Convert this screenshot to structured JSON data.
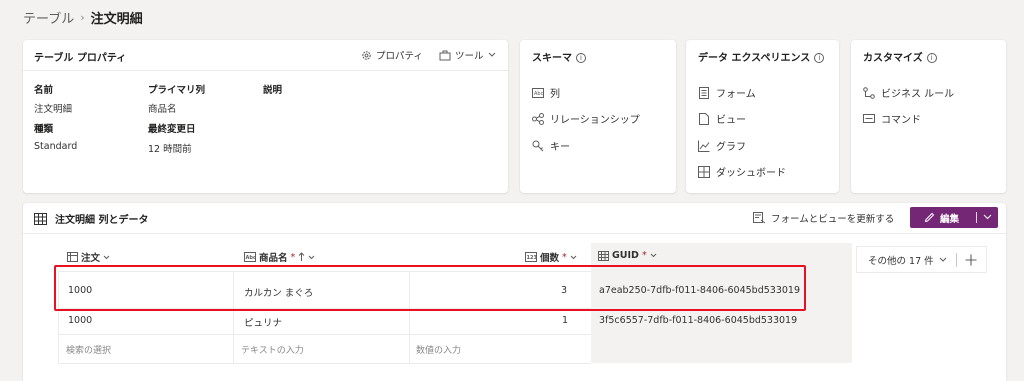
{
  "breadcrumb": {
    "parent": "テーブル",
    "separator": "›",
    "current": "注文明細"
  },
  "properties_card": {
    "title": "テーブル プロパティ",
    "properties_button": "プロパティ",
    "tools_button": "ツール",
    "labels": {
      "name": "名前",
      "primary": "プライマリ列",
      "description": "説明",
      "type": "種類",
      "modified": "最終変更日"
    },
    "values": {
      "name": "注文明細",
      "primary": "商品名",
      "type": "Standard",
      "modified": "12 時間前"
    }
  },
  "schema_card": {
    "title": "スキーマ",
    "items": [
      "列",
      "リレーションシップ",
      "キー"
    ]
  },
  "experience_card": {
    "title": "データ エクスペリエンス",
    "items": [
      "フォーム",
      "ビュー",
      "グラフ",
      "ダッシュボード"
    ]
  },
  "customize_card": {
    "title": "カスタマイズ",
    "items": [
      "ビジネス ルール",
      "コマンド"
    ]
  },
  "data_section": {
    "title": "注文明細 列とデータ",
    "update_button": "フォームとビューを更新する",
    "edit_button": "編集",
    "columns": [
      "注文",
      "商品名",
      "個数",
      "GUID"
    ],
    "required_mark": "*",
    "more_columns": "その他の 17 件",
    "rows": [
      [
        "1000",
        "カルカン まぐろ",
        "3",
        "a7eab250-7dfb-f011-8406-6045bd533019"
      ],
      [
        "1000",
        "ピュリナ",
        "1",
        "3f5c6557-7dfb-f011-8406-6045bd533019"
      ]
    ],
    "placeholders": [
      "検索の選択",
      "テキストの入力",
      "数値の入力"
    ]
  },
  "colors": {
    "accent": "#742774",
    "highlight": "#e81123"
  }
}
